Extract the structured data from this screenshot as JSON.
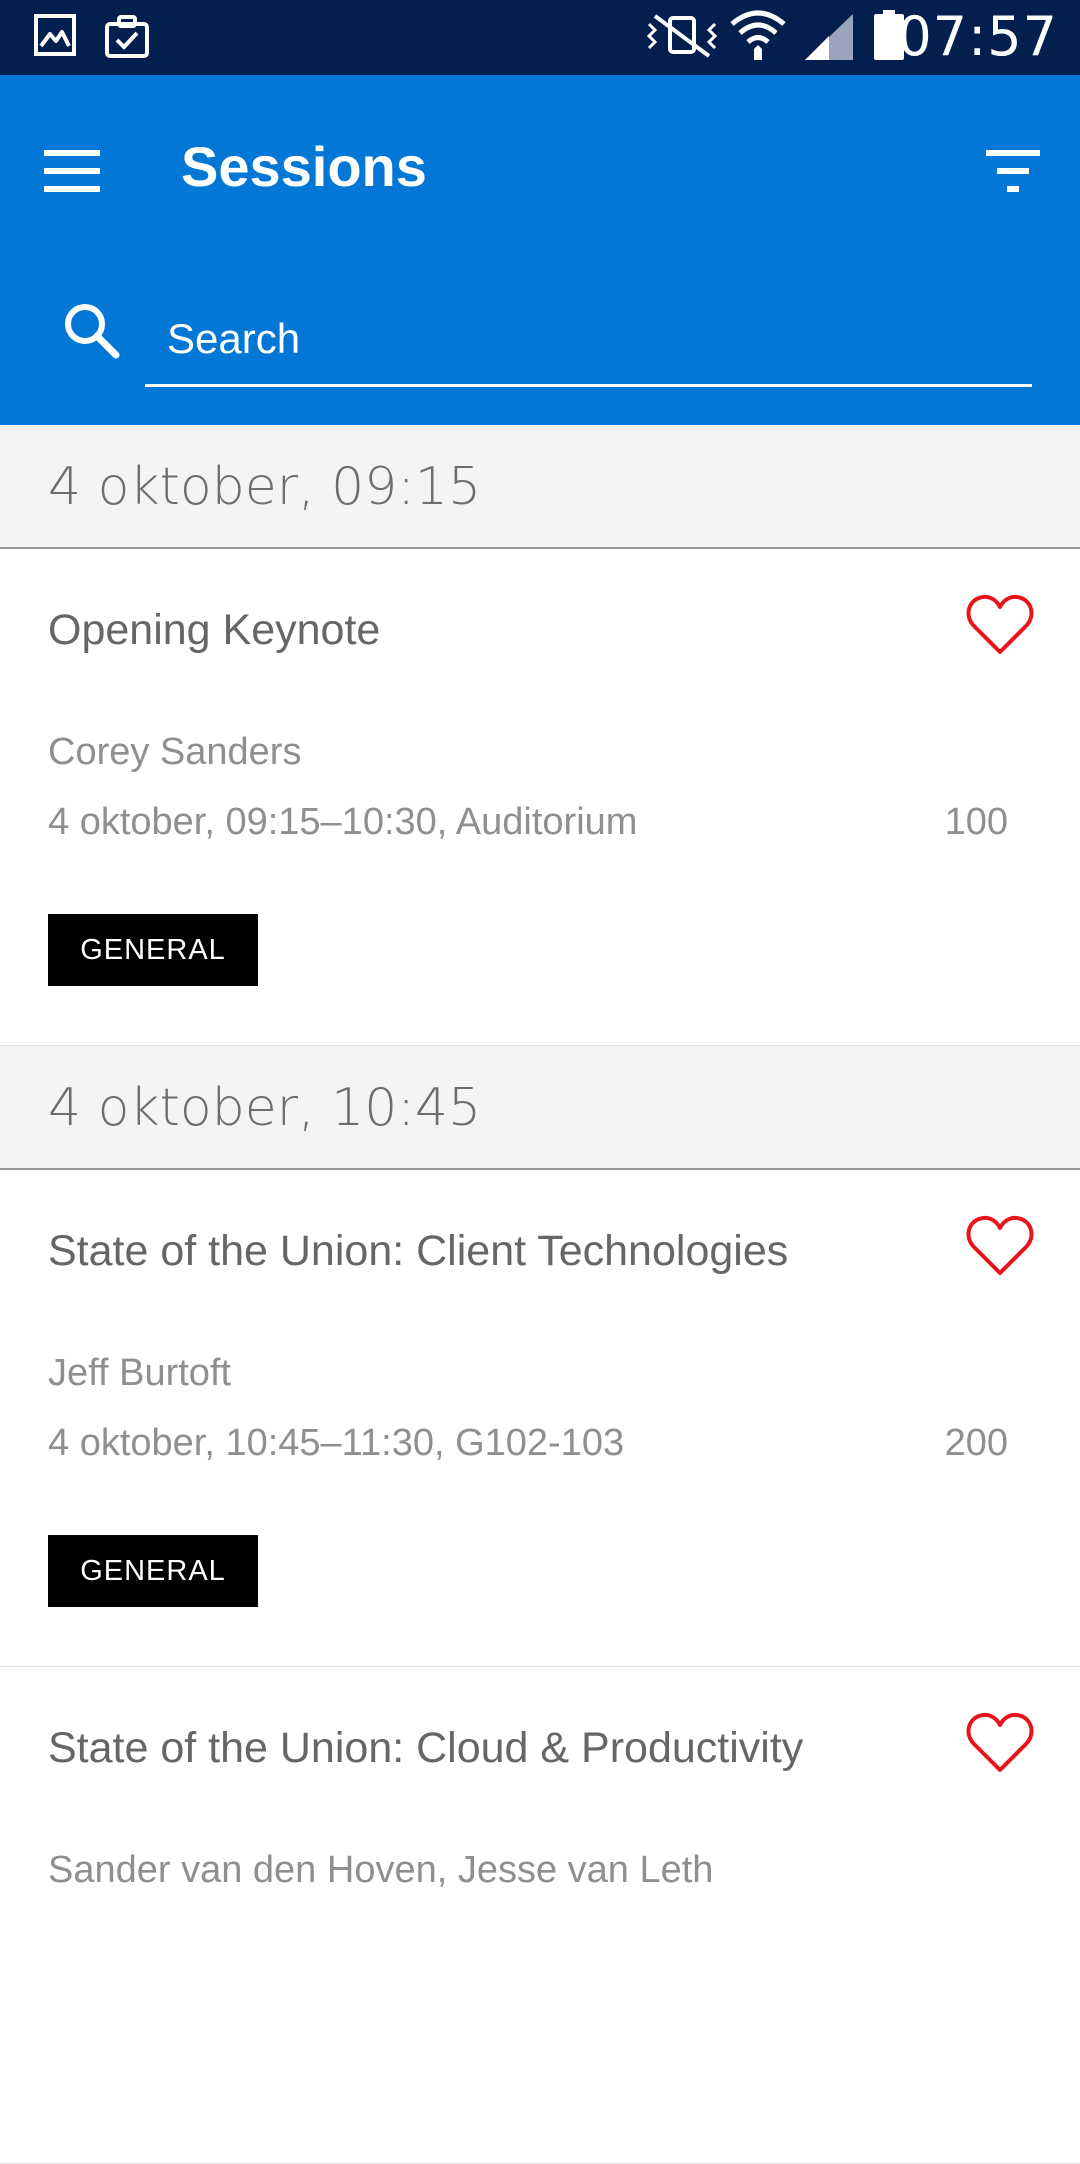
{
  "status_bar": {
    "time": "07:57",
    "left_icons": [
      "gallery-icon",
      "clipboard-check-icon"
    ],
    "right_icons": [
      "mute-vibrate-icon",
      "wifi-icon",
      "signal-icon",
      "battery-icon"
    ]
  },
  "app_bar": {
    "title": "Sessions",
    "menu_icon": "hamburger-menu-icon",
    "filter_icon": "filter-icon",
    "search": {
      "placeholder": "Search",
      "value": ""
    },
    "colors": {
      "background": "#0277d6",
      "status_bar": "#031f4d"
    }
  },
  "sections": [
    {
      "header": "4 oktober, 09:15",
      "sessions": [
        {
          "title": "Opening Keynote",
          "speakers": "Corey Sanders",
          "details": "4 oktober, 09:15–10:30, Auditorium",
          "level": "100",
          "tag": "GENERAL",
          "favorite": false
        }
      ]
    },
    {
      "header": "4 oktober, 10:45",
      "sessions": [
        {
          "title": "State of the Union: Client Technologies",
          "speakers": "Jeff Burtoft",
          "details": "4 oktober, 10:45–11:30, G102-103",
          "level": "200",
          "tag": "GENERAL",
          "favorite": false
        },
        {
          "title": "State of the Union: Cloud & Productivity",
          "speakers": "Sander van den Hoven, Jesse van Leth",
          "details": "",
          "level": "",
          "tag": "",
          "favorite": false
        }
      ]
    }
  ],
  "accent_colors": {
    "heart": "#e8141c",
    "tag_background": "#000000"
  }
}
